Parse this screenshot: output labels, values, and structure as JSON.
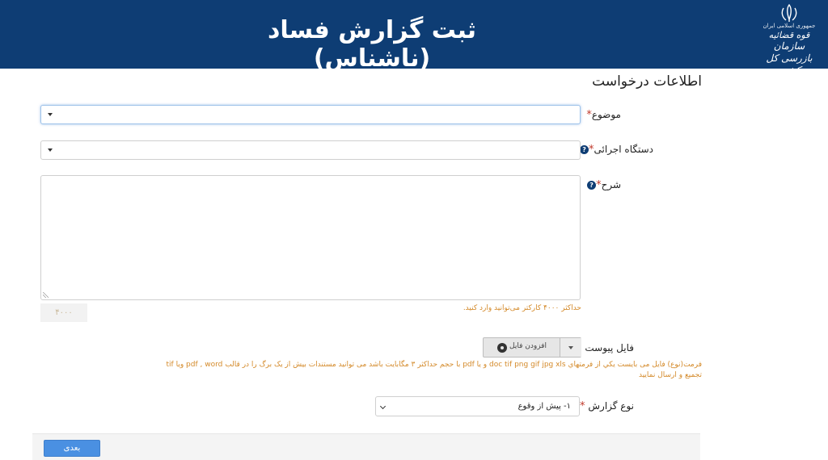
{
  "header": {
    "title": "ثبت گزارش فساد (ناشناس)",
    "logo_line1": "جمهوری اسلامی ایران",
    "logo_line2": "قوه قضائیه",
    "logo_line3": "سازمان بازرسی کل کشور"
  },
  "form": {
    "section_title": "اطلاعات درخواست",
    "subject_label": "موضوع",
    "agency_label": "دستگاه اجرائی",
    "description_label": "شرح",
    "required_mark": "*",
    "help_mark": "?",
    "char_counter": "۴۰۰۰",
    "max_chars_note": "حداکثر ۴۰۰۰ کارکتر می‌توانید وارد کنید.",
    "attachment_label": "فایل پیوست",
    "add_file_label": "افزودن فایل",
    "format_note_line1": "فرمت(نوع) فایل می بایست یکي از فرمتهاي doc tif png gif jpg xls و یا pdf با حجم حداکثر ۳ مگابایت باشد می توانید مستندات بیش از یک برگ را در قالب pdf , word ویا tif",
    "format_note_line2": "تجمیع و ارسال نمایید",
    "report_type_label": "نوع گزارش",
    "report_type_value": "۱- پیش از وقوع"
  },
  "footer": {
    "next_label": "بعدی"
  },
  "colors": {
    "header_bg": "#0e3d74",
    "accent": "#4a90e2",
    "note": "#d48a2a",
    "required": "#c0392b"
  }
}
